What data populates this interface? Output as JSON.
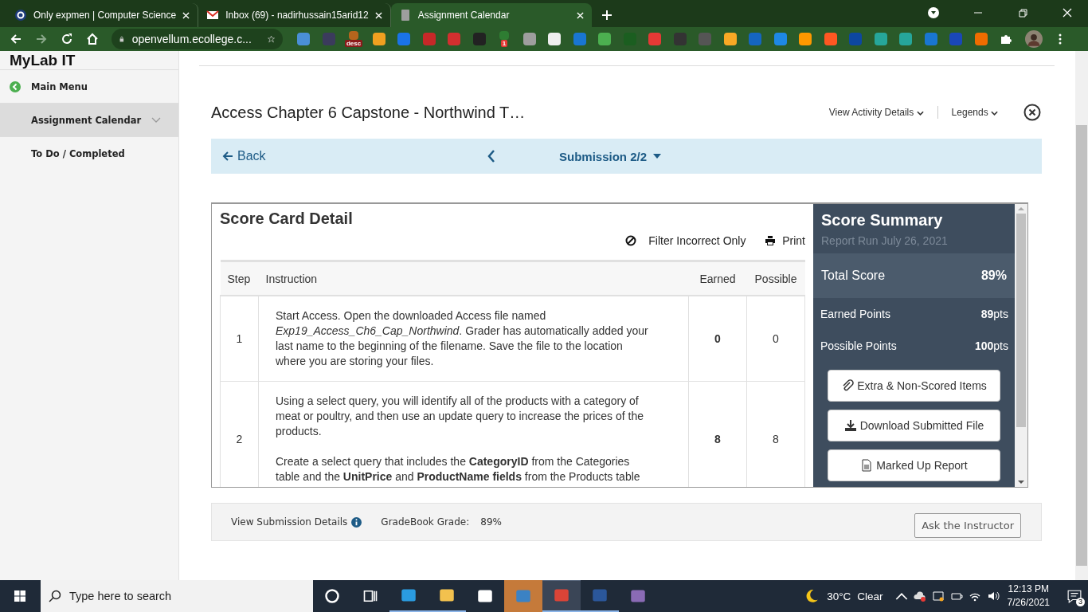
{
  "browser": {
    "tabs": [
      {
        "title": "Only expmen | Computer Science",
        "kind": "site",
        "selected": false
      },
      {
        "title": "Inbox (69) - nadirhussain15arid12",
        "kind": "mail",
        "selected": false
      },
      {
        "title": "Assignment Calendar",
        "kind": "page",
        "selected": true
      }
    ],
    "address": "openvellum.ecollege.c...",
    "extension_badges": [
      "desc",
      "1"
    ]
  },
  "sidebar": {
    "logo": "MyLab IT",
    "items": [
      {
        "label": "Main Menu",
        "kind": "back",
        "selected": false
      },
      {
        "label": "Assignment Calendar",
        "kind": "expandable",
        "selected": true
      },
      {
        "label": "To Do / Completed",
        "kind": "plain",
        "selected": false
      }
    ]
  },
  "page": {
    "title": "Access Chapter 6 Capstone - Northwind T…",
    "header_links": [
      "View Activity Details",
      "Legends"
    ]
  },
  "nav": {
    "back": "Back",
    "submission": "Submission 2/2"
  },
  "score_card": {
    "title": "Score Card Detail",
    "filter": "Filter Incorrect Only",
    "print": "Print",
    "columns": [
      "Step",
      "Instruction",
      "Earned",
      "Possible"
    ],
    "rows": [
      {
        "step": "1",
        "instruction": [
          "Start Access. Open the downloaded Access file named *Exp19_Access_Ch6_Cap_Northwind*. Grader has automatically added your last name to the beginning of the filename. Save the file to the location where you are storing your files."
        ],
        "earned": "0",
        "possible": "0"
      },
      {
        "step": "2",
        "instruction": [
          "Using a select query, you will identify all of the products with a category of meat or poultry, and then use an update query to increase the prices of the products.",
          "Create a select query that includes the **CategoryID** from the Categories table and the **UnitPrice** and **ProductName fields** from the Products table"
        ],
        "earned": "8",
        "possible": "8"
      }
    ]
  },
  "summary": {
    "title": "Score Summary",
    "report_run": "Report Run July 26, 2021",
    "total_label": "Total Score",
    "total": "89%",
    "points": [
      {
        "label": "Earned Points",
        "value": "**89**pts"
      },
      {
        "label": "Possible Points",
        "value": "**100**pts"
      }
    ],
    "buttons": [
      {
        "label": "Extra & Non-Scored Items",
        "kind": "attachment"
      },
      {
        "label": "Download Submitted File",
        "kind": "download"
      },
      {
        "label": "Marked Up Report",
        "kind": "document"
      }
    ]
  },
  "footer": {
    "details": "View Submission Details",
    "grade_label": "GradeBook Grade:",
    "grade": "89%",
    "ask": "Ask the Instructor"
  },
  "taskbar": {
    "search_placeholder": "Type here to search",
    "apps": [
      {
        "kind": "cortana",
        "running": false,
        "attention": false,
        "selected": false
      },
      {
        "kind": "taskview",
        "running": false,
        "attention": false,
        "selected": false
      },
      {
        "kind": "edge",
        "running": true,
        "attention": false,
        "selected": false
      },
      {
        "kind": "explorer",
        "running": true,
        "attention": false,
        "selected": false
      },
      {
        "kind": "store",
        "running": false,
        "attention": false,
        "selected": false
      },
      {
        "kind": "mail",
        "running": false,
        "attention": true,
        "selected": false
      },
      {
        "kind": "chrome",
        "running": true,
        "attention": false,
        "selected": true
      },
      {
        "kind": "word",
        "running": true,
        "attention": false,
        "selected": false
      },
      {
        "kind": "video",
        "running": false,
        "attention": false,
        "selected": false
      }
    ],
    "weather": "30°C",
    "condition": "Clear",
    "time": "12:13 PM",
    "date": "7/26/2021",
    "notifications": "3"
  }
}
